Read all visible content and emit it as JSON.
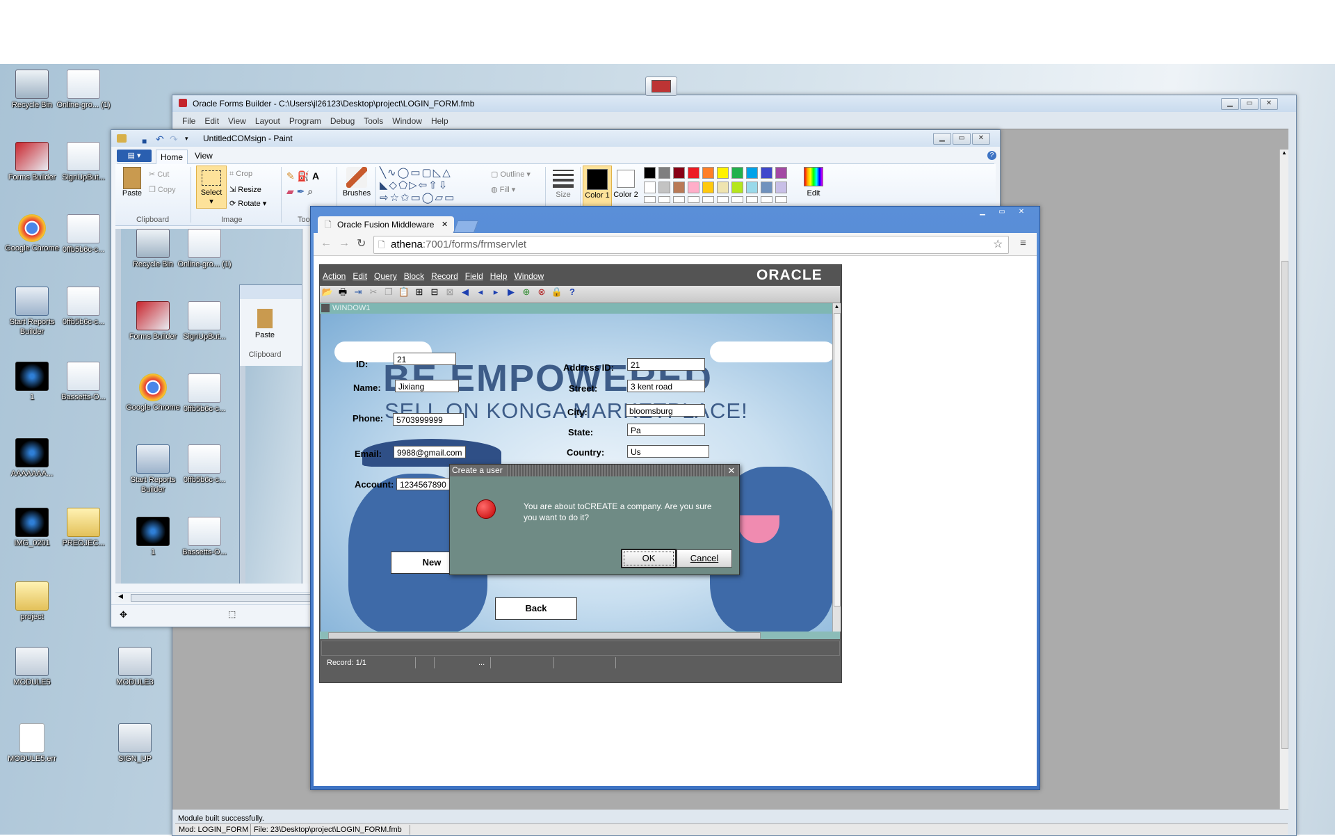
{
  "desktop": {
    "icons_left": [
      {
        "label": "Recycle Bin",
        "icon": "recycle-bin-icon"
      },
      {
        "label": "Online-gro... (1)",
        "icon": "image-file-icon"
      },
      {
        "label": "Forms Builder",
        "icon": "forms-builder-icon"
      },
      {
        "label": "SignUpBut...",
        "icon": "image-file-icon"
      },
      {
        "label": "Google Chrome",
        "icon": "chrome-icon"
      },
      {
        "label": "0ffb5b6c-c...",
        "icon": "image-file-icon"
      },
      {
        "label": "Start Reports Builder",
        "icon": "reports-builder-icon"
      },
      {
        "label": "0ffb5b6c-c...",
        "icon": "image-file-icon"
      },
      {
        "label": "1",
        "icon": "video-file-icon"
      },
      {
        "label": "Bassetts-O...",
        "icon": "image-file-icon"
      },
      {
        "label": "AAAAAAA...",
        "icon": "video-file-icon"
      },
      {
        "label": "IMG_0201",
        "icon": "video-file-icon"
      },
      {
        "label": "PREOJEC...",
        "icon": "folder-icon"
      },
      {
        "label": "project",
        "icon": "folder-icon"
      },
      {
        "label": "MODULE5",
        "icon": "module-file-icon"
      },
      {
        "label": "MODULE3",
        "icon": "module-file-icon"
      },
      {
        "label": "MODULE5.err",
        "icon": "text-file-icon"
      },
      {
        "label": "SIGN_UP",
        "icon": "module-file-icon"
      }
    ]
  },
  "forms_builder": {
    "title": "Oracle Forms Builder - C:\\Users\\jl26123\\Desktop\\project\\LOGIN_FORM.fmb",
    "menu": [
      "File",
      "Edit",
      "View",
      "Layout",
      "Program",
      "Debug",
      "Tools",
      "Window",
      "Help"
    ],
    "status_line1": "Module built successfully.",
    "status_mod": "Mod: LOGIN_FORM",
    "status_file": "File: 23\\Desktop\\project\\LOGIN_FORM.fmb"
  },
  "paint": {
    "title": "UntitledCOMsign - Paint",
    "tabs": [
      "Home",
      "View"
    ],
    "clipboard": {
      "paste": "Paste",
      "cut": "Cut",
      "copy": "Copy",
      "group": "Clipboard"
    },
    "image": {
      "select": "Select",
      "crop": "Crop",
      "resize": "Resize",
      "rotate": "Rotate",
      "group": "Image"
    },
    "tools_group": "Tools",
    "brushes": "Brushes",
    "shapes": {
      "outline": "Outline",
      "fill": "Fill"
    },
    "size": "Size",
    "color1": "Color 1",
    "color2": "Color 2",
    "edit_colors": "Edit colors",
    "palette": [
      "#000000",
      "#7f7f7f",
      "#880015",
      "#ed1c24",
      "#ff7f27",
      "#fff200",
      "#22b14c",
      "#00a2e8",
      "#3f48cc",
      "#a349a4",
      "#ffffff",
      "#c3c3c3",
      "#b97a57",
      "#ffaec9",
      "#ffc90e",
      "#efe4b0",
      "#b5e61d",
      "#99d9ea",
      "#7092be",
      "#c8bfe7"
    ]
  },
  "paint_inner": {
    "clipboard_group": "Clipboard",
    "paste": "Paste"
  },
  "chrome": {
    "tab_title": "Oracle Fusion Middleware",
    "url_host": "athena",
    "url_rest": ":7001/forms/frmservlet"
  },
  "oracle_form": {
    "menu": [
      "Action",
      "Edit",
      "Query",
      "Block",
      "Record",
      "Field",
      "Help",
      "Window"
    ],
    "logo": "ORACLE",
    "window_title": "WINDOW1",
    "banner_line1": "BE EMPOWERED",
    "banner_line2": "SELL ON KONGA MARKETPLACE!",
    "labels": {
      "id": "ID:",
      "name": "Name:",
      "phone": "Phone:",
      "email": "Email:",
      "account": "Account:",
      "address_id": "Address ID:",
      "street": "Street:",
      "city": "City:",
      "state": "State:",
      "country": "Country:"
    },
    "values": {
      "id": "21",
      "name": "Jixiang",
      "phone": "5703999999",
      "email": "9988@gmail.com",
      "account": "1234567890",
      "address_id": "21",
      "street": "3 kent road",
      "city": "bloomsburg",
      "state": "Pa",
      "country": "Us"
    },
    "new_button": "New",
    "back_button": "Back",
    "status_record": "Record: 1/1",
    "status_dots": "..."
  },
  "dialog": {
    "title": "Create a user",
    "message": "You are about toCREATE a company. Are you sure you want to do it?",
    "ok": "OK",
    "cancel": "Cancel"
  }
}
